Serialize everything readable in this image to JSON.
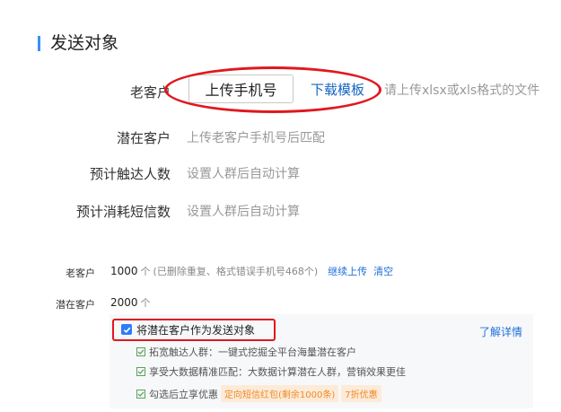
{
  "section": {
    "title": "发送对象"
  },
  "old_customer": {
    "label": "老客户",
    "upload_button": "上传手机号",
    "download_link": "下载模板",
    "hint": "请上传xlsx或xls格式的文件"
  },
  "potential_customer": {
    "label": "潜在客户",
    "hint": "上传老客户手机号后匹配"
  },
  "reach": {
    "label": "预计触达人数",
    "hint": "设置人群后自动计算"
  },
  "sms_cost": {
    "label": "预计消耗短信数",
    "hint": "设置人群后自动计算"
  },
  "summary": {
    "old_label": "老客户",
    "old_count": "1000",
    "old_unit": "个",
    "old_note": "(已删除重复、格式错误手机号468个)",
    "continue_upload": "继续上传",
    "clear": "清空",
    "potential_label": "潜在客户",
    "potential_count": "2000",
    "potential_unit": "个"
  },
  "panel": {
    "checkbox_checked": true,
    "checkbox_label": "将潜在客户作为发送对象",
    "detail_link": "了解详情",
    "features": [
      "拓宽触达人群：一键式挖掘全平台海量潜在客户",
      "享受大数据精准匹配：大数据计算潜在人群，营销效果更佳",
      "勾选后立享优惠"
    ],
    "promo_tag": "定向短信红包(剩余1000条)",
    "discount_tag": "7折优惠"
  },
  "colors": {
    "accent": "#3a8ef6",
    "link": "#1e6fd9",
    "annotation_red": "#e0181e",
    "promo": "#f08a24"
  }
}
